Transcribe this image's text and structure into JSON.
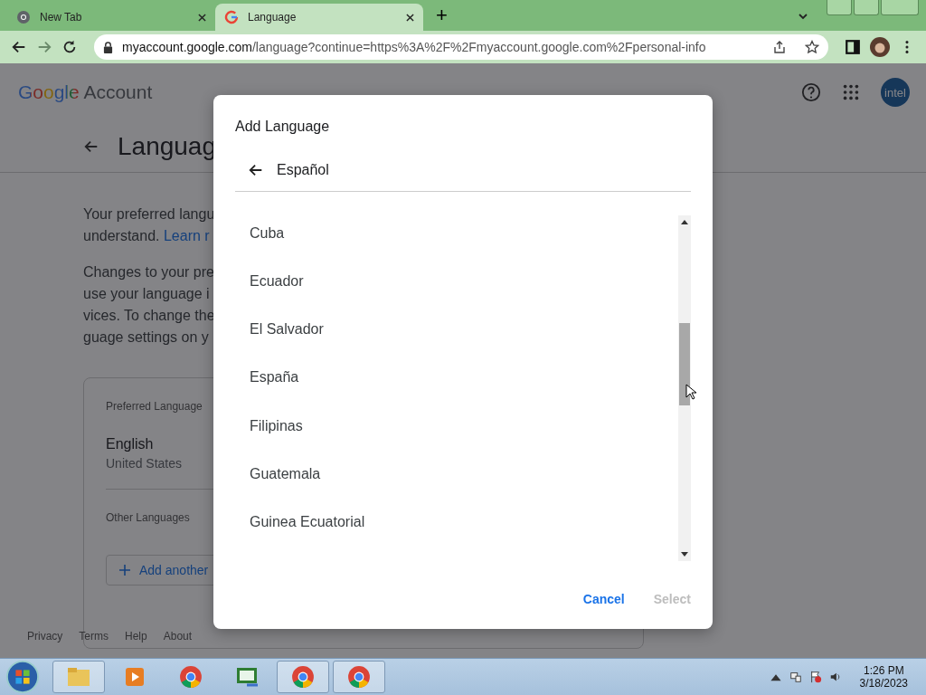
{
  "browser": {
    "tabs": [
      {
        "title": "New Tab",
        "selected": false
      },
      {
        "title": "Language",
        "selected": true
      }
    ],
    "new_tab": "+",
    "url": {
      "host": "myaccount.google.com",
      "path": "/language?continue=https%3A%2F%2Fmyaccount.google.com%2Fpersonal-info"
    }
  },
  "page": {
    "logo": {
      "brand": "Google",
      "product": "Account"
    },
    "avatar": "intel",
    "heading": "Languag",
    "paragraphs": [
      [
        "Your preferred langu",
        {
          "text": "understand. ",
          "link": "Learn r"
        }
      ],
      [
        "Changes to your pre",
        "use your language i",
        "vices. To change the",
        "guage settings on y"
      ]
    ],
    "card": {
      "preferred_label": "Preferred Language",
      "language": "English",
      "region": "United States",
      "other_label": "Other Languages",
      "add_button": "Add another"
    },
    "footer": [
      "Privacy",
      "Terms",
      "Help",
      "About"
    ]
  },
  "dialog": {
    "title": "Add Language",
    "language": "Español",
    "items": [
      "Cuba",
      "Ecuador",
      "El Salvador",
      "España",
      "Filipinas",
      "Guatemala",
      "Guinea Ecuatorial"
    ],
    "buttons": [
      {
        "label": "Cancel",
        "disabled": false
      },
      {
        "label": "Select",
        "disabled": true
      }
    ]
  },
  "taskbar": {
    "time": "1:26 PM",
    "date": "3/18/2023"
  }
}
